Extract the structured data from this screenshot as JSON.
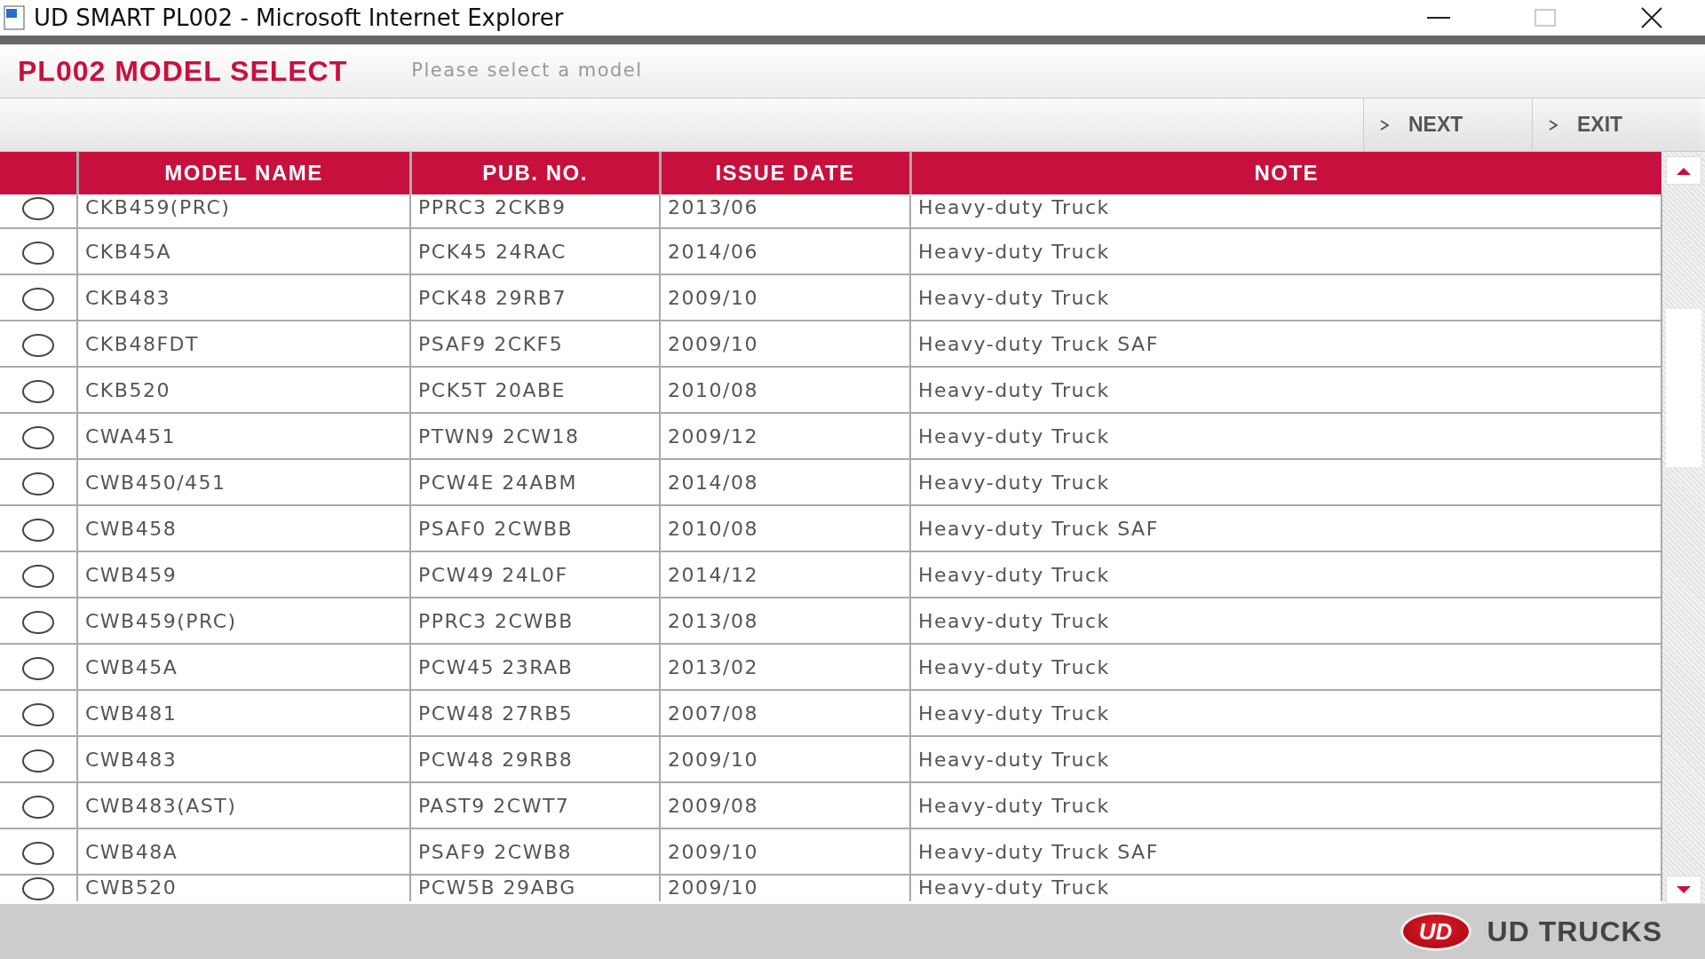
{
  "window": {
    "title": "UD SMART PL002 - Microsoft Internet Explorer"
  },
  "header": {
    "title": "PL002 MODEL SELECT",
    "subtitle": "Please select a model"
  },
  "toolbar": {
    "buttons": [
      {
        "label": "NEXT"
      },
      {
        "label": "EXIT"
      }
    ]
  },
  "table": {
    "columns": [
      "MODEL NAME",
      "PUB. NO.",
      "ISSUE DATE",
      "NOTE"
    ],
    "rows": [
      {
        "selected": false,
        "cells": [
          "CKB459(PRC)",
          "PPRC3 2CKB9",
          "2013/06",
          "Heavy-duty Truck"
        ]
      },
      {
        "selected": false,
        "cells": [
          "CKB45A",
          "PCK45 24RAC",
          "2014/06",
          "Heavy-duty Truck"
        ]
      },
      {
        "selected": false,
        "cells": [
          "CKB483",
          "PCK48 29RB7",
          "2009/10",
          "Heavy-duty Truck"
        ]
      },
      {
        "selected": false,
        "cells": [
          "CKB48FDT",
          "PSAF9 2CKF5",
          "2009/10",
          "Heavy-duty Truck SAF"
        ]
      },
      {
        "selected": false,
        "cells": [
          "CKB520",
          "PCK5T 20ABE",
          "2010/08",
          "Heavy-duty Truck"
        ]
      },
      {
        "selected": false,
        "cells": [
          "CWA451",
          "PTWN9 2CW18",
          "2009/12",
          "Heavy-duty Truck"
        ]
      },
      {
        "selected": false,
        "cells": [
          "CWB450/451",
          "PCW4E 24ABM",
          "2014/08",
          "Heavy-duty Truck"
        ]
      },
      {
        "selected": false,
        "cells": [
          "CWB458",
          "PSAF0 2CWBB",
          "2010/08",
          "Heavy-duty Truck SAF"
        ]
      },
      {
        "selected": false,
        "cells": [
          "CWB459",
          "PCW49 24L0F",
          "2014/12",
          "Heavy-duty Truck"
        ]
      },
      {
        "selected": false,
        "cells": [
          "CWB459(PRC)",
          "PPRC3 2CWBB",
          "2013/08",
          "Heavy-duty Truck"
        ]
      },
      {
        "selected": false,
        "cells": [
          "CWB45A",
          "PCW45 23RAB",
          "2013/02",
          "Heavy-duty Truck"
        ]
      },
      {
        "selected": false,
        "cells": [
          "CWB481",
          "PCW48 27RB5",
          "2007/08",
          "Heavy-duty Truck"
        ]
      },
      {
        "selected": false,
        "cells": [
          "CWB483",
          "PCW48 29RB8",
          "2009/10",
          "Heavy-duty Truck"
        ]
      },
      {
        "selected": false,
        "cells": [
          "CWB483(AST)",
          "PAST9 2CWT7",
          "2009/08",
          "Heavy-duty Truck"
        ]
      },
      {
        "selected": false,
        "cells": [
          "CWB48A",
          "PSAF9 2CWB8",
          "2009/10",
          "Heavy-duty Truck SAF"
        ]
      },
      {
        "selected": false,
        "cells": [
          "CWB520",
          "PCW5B 29ABG",
          "2009/10",
          "Heavy-duty Truck"
        ]
      }
    ]
  },
  "footer": {
    "logo_mark": "UD",
    "brand": "UD TRUCKS"
  }
}
